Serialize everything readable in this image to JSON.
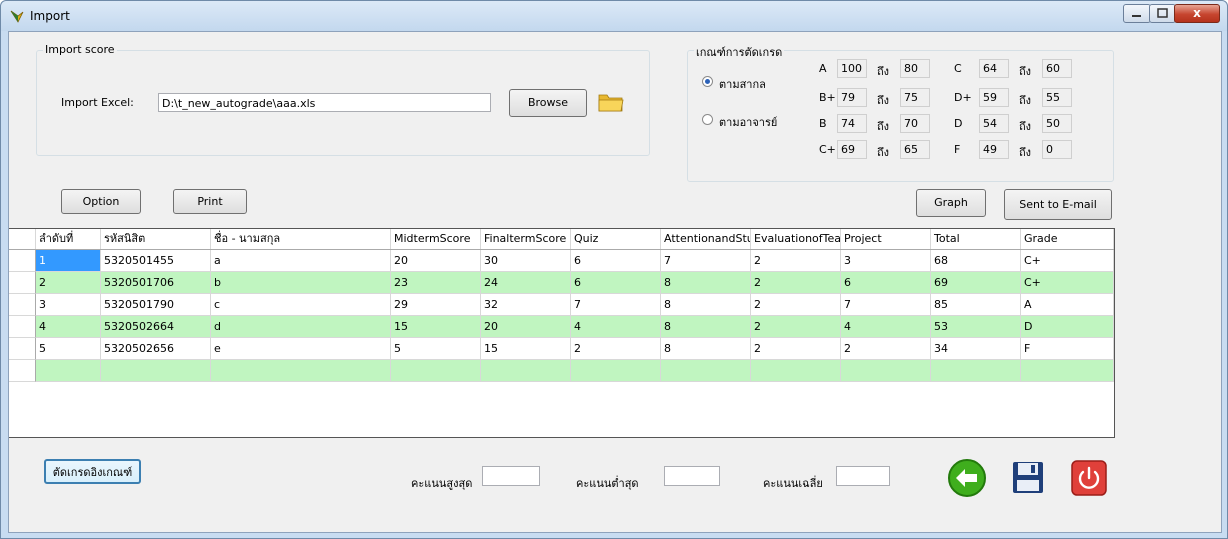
{
  "window": {
    "title": "Import",
    "close_glyph": "x"
  },
  "import_group": {
    "title": "Import score",
    "excel_label": "Import Excel:",
    "file_path": "D:\\t_new_autograde\\aaa.xls",
    "browse_label": "Browse"
  },
  "criteria_group": {
    "title": "เกณฑ์การตัดเกรด",
    "radio_standard": "ตามสากล",
    "radio_teacher": "ตามอาจารย์",
    "to_label": "ถึง",
    "grades": [
      {
        "grade": "A",
        "from": "100",
        "to": "80"
      },
      {
        "grade": "B+",
        "from": "79",
        "to": "75"
      },
      {
        "grade": "B",
        "from": "74",
        "to": "70"
      },
      {
        "grade": "C+",
        "from": "69",
        "to": "65"
      },
      {
        "grade": "C",
        "from": "64",
        "to": "60"
      },
      {
        "grade": "D+",
        "from": "59",
        "to": "55"
      },
      {
        "grade": "D",
        "from": "54",
        "to": "50"
      },
      {
        "grade": "F",
        "from": "49",
        "to": "0"
      }
    ]
  },
  "toolbar": {
    "option_label": "Option",
    "print_label": "Print",
    "graph_label": "Graph",
    "email_label": "Sent to E-mail"
  },
  "table": {
    "columns": [
      "ลำดับที่",
      "รหัสนิสิต",
      "ชื่อ - นามสกุล",
      "MidtermScore",
      "FinaltermScore",
      "Quiz",
      "AttentionandStud",
      "EvaluationofTeac",
      "Project",
      "Total",
      "Grade"
    ],
    "rows": [
      [
        "1",
        "5320501455",
        "a",
        "20",
        "30",
        "6",
        "7",
        "2",
        "3",
        "68",
        "C+"
      ],
      [
        "2",
        "5320501706",
        "b",
        "23",
        "24",
        "6",
        "8",
        "2",
        "6",
        "69",
        "C+"
      ],
      [
        "3",
        "5320501790",
        "c",
        "29",
        "32",
        "7",
        "8",
        "2",
        "7",
        "85",
        "A"
      ],
      [
        "4",
        "5320502664",
        "d",
        "15",
        "20",
        "4",
        "8",
        "2",
        "4",
        "53",
        "D"
      ],
      [
        "5",
        "5320502656",
        "e",
        "5",
        "15",
        "2",
        "8",
        "2",
        "2",
        "34",
        "F"
      ]
    ]
  },
  "footer": {
    "cut_grade_label": "ตัดเกรดอิงเกณฑ์",
    "max_label": "คะแนนสูงสุด",
    "min_label": "คะแนนต่ำสุด",
    "avg_label": "คะแนนเฉลี่ย"
  },
  "icons": {
    "app": "app-icon",
    "folder": "folder-icon",
    "back": "back-arrow-icon",
    "save": "save-disk-icon",
    "power": "power-icon"
  },
  "colors": {
    "row_alt": "#c0f5c0",
    "selected": "#3399ff",
    "back_green": "#3fae1d",
    "power_red": "#e0403a"
  }
}
